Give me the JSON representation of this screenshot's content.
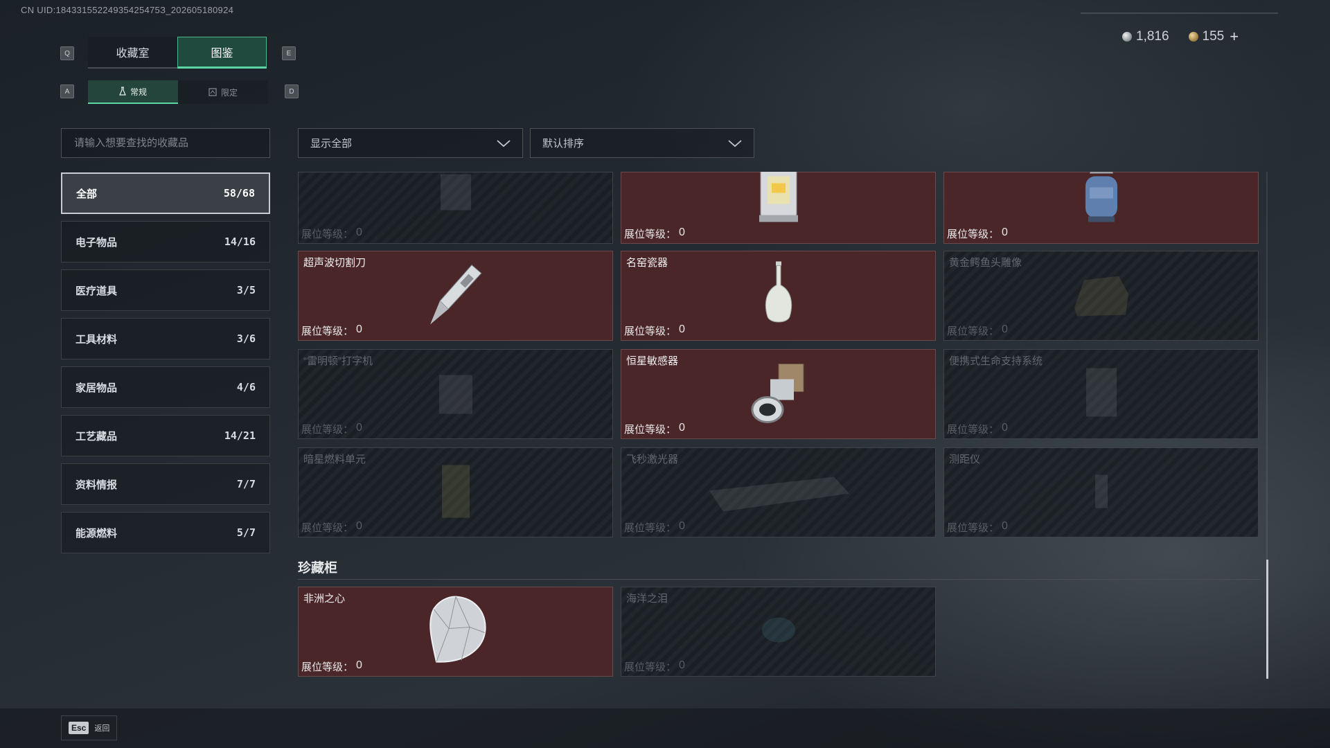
{
  "uid": "CN UID:18433155224935425475З_202605180924",
  "currency": [
    {
      "icon": "silver-coin-icon",
      "value": "1,816"
    },
    {
      "icon": "gold-coin-icon",
      "value": "155"
    }
  ],
  "currency_add": "+",
  "keys": {
    "left_tab": "Q",
    "right_tab": "E",
    "left_sub": "A",
    "right_sub": "D"
  },
  "tabs": [
    {
      "label": "收藏室",
      "active": false
    },
    {
      "label": "图鉴",
      "active": true
    }
  ],
  "subtabs": [
    {
      "label": "常规",
      "icon": "flask-icon",
      "active": true
    },
    {
      "label": "限定",
      "icon": "limited-icon",
      "active": false
    }
  ],
  "search": {
    "placeholder": "请输入想要查找的收藏品"
  },
  "categories": [
    {
      "label": "全部",
      "count": "58/68",
      "active": true
    },
    {
      "label": "电子物品",
      "count": "14/16"
    },
    {
      "label": "医疗道具",
      "count": "3/5"
    },
    {
      "label": "工具材料",
      "count": "3/6"
    },
    {
      "label": "家居物品",
      "count": "4/6"
    },
    {
      "label": "工艺藏品",
      "count": "14/21"
    },
    {
      "label": "资料情报",
      "count": "7/7"
    },
    {
      "label": "能源燃料",
      "count": "5/7"
    }
  ],
  "filter": {
    "label": "显示全部"
  },
  "sort": {
    "label": "默认排序"
  },
  "level_label": "展位等级：",
  "items": [
    {
      "name": "",
      "owned": false,
      "level": "0",
      "art": "generic"
    },
    {
      "name": "",
      "owned": true,
      "level": "0",
      "art": "lantern"
    },
    {
      "name": "",
      "owned": true,
      "level": "0",
      "art": "gas-canister"
    },
    {
      "name": "超声波切割刀",
      "owned": true,
      "level": "0",
      "art": "knife"
    },
    {
      "name": "名窑瓷器",
      "owned": true,
      "level": "0",
      "art": "vase"
    },
    {
      "name": "黄金鳄鱼头雕像",
      "owned": false,
      "level": "0",
      "art": "statue"
    },
    {
      "name": "“雷明顿”打字机",
      "owned": false,
      "level": "0",
      "art": "typewriter"
    },
    {
      "name": "恒星敏感器",
      "owned": true,
      "level": "0",
      "art": "sensor"
    },
    {
      "name": "便携式生命支持系统",
      "owned": false,
      "level": "0",
      "art": "life-support"
    },
    {
      "name": "暗星燃料单元",
      "owned": false,
      "level": "0",
      "art": "fuel-cell"
    },
    {
      "name": "飞秒激光器",
      "owned": false,
      "level": "0",
      "art": "laser"
    },
    {
      "name": "测距仪",
      "owned": false,
      "level": "0",
      "art": "rangefinder"
    }
  ],
  "section": {
    "title": "珍藏柜"
  },
  "treasures": [
    {
      "name": "非洲之心",
      "owned": true,
      "level": "0",
      "art": "diamond"
    },
    {
      "name": "海洋之泪",
      "owned": false,
      "level": "0",
      "art": "gem"
    }
  ],
  "footer": {
    "key": "Esc",
    "label": "返回"
  }
}
